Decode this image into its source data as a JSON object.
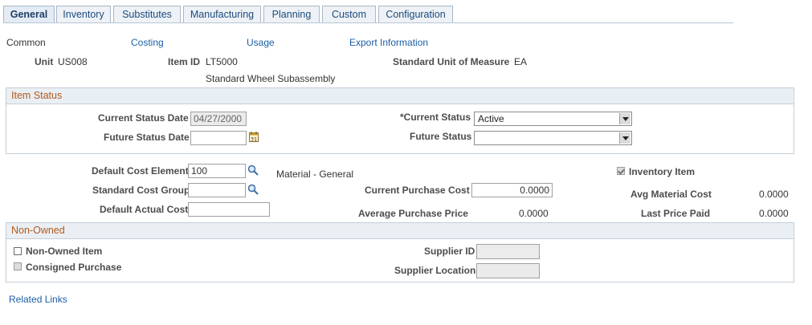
{
  "tabs": [
    {
      "label": "General",
      "active": true
    },
    {
      "label": "Inventory",
      "active": false
    },
    {
      "label": "Substitutes",
      "active": false
    },
    {
      "label": "Manufacturing",
      "active": false
    },
    {
      "label": "Planning",
      "active": false
    },
    {
      "label": "Custom",
      "active": false
    },
    {
      "label": "Configuration",
      "active": false
    }
  ],
  "subnav": {
    "common": "Common",
    "costing": "Costing",
    "usage": "Usage",
    "export": "Export Information"
  },
  "header": {
    "unit_label": "Unit",
    "unit_value": "US008",
    "item_id_label": "Item ID",
    "item_id_value": "LT5000",
    "item_desc": "Standard Wheel Subassembly",
    "uom_label": "Standard Unit of Measure",
    "uom_value": "EA"
  },
  "item_status": {
    "title": "Item Status",
    "current_status_date_label": "Current Status Date",
    "current_status_date_value": "04/27/2000",
    "future_status_date_label": "Future Status Date",
    "future_status_date_value": "",
    "current_status_label": "*Current Status",
    "current_status_value": "Active",
    "future_status_label": "Future Status",
    "future_status_value": ""
  },
  "costs": {
    "default_cost_element_label": "Default Cost Element",
    "default_cost_element_value": "100",
    "cost_element_desc": "Material - General",
    "standard_cost_group_label": "Standard Cost Group",
    "standard_cost_group_value": "",
    "default_actual_cost_label": "Default Actual Cost",
    "default_actual_cost_value": "",
    "current_purchase_cost_label": "Current Purchase Cost",
    "current_purchase_cost_value": "0.0000",
    "average_purchase_price_label": "Average Purchase Price",
    "average_purchase_price_value": "0.0000",
    "inventory_item_label": "Inventory Item",
    "inventory_item_checked": true,
    "avg_material_cost_label": "Avg Material Cost",
    "avg_material_cost_value": "0.0000",
    "last_price_paid_label": "Last Price Paid",
    "last_price_paid_value": "0.0000"
  },
  "non_owned": {
    "title": "Non-Owned",
    "non_owned_item_label": "Non-Owned Item",
    "consigned_purchase_label": "Consigned Purchase",
    "supplier_id_label": "Supplier ID",
    "supplier_id_value": "",
    "supplier_location_label": "Supplier Location",
    "supplier_location_value": ""
  },
  "related_links": "Related Links"
}
